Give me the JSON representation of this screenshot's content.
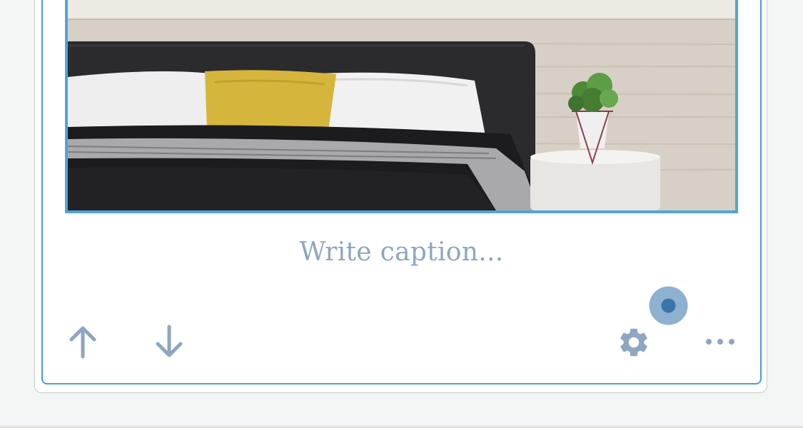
{
  "caption": {
    "placeholder": "Write caption..."
  },
  "image": {
    "alt": "Bedroom with dark upholstered bed, yellow pillow and potted plant on nightstand"
  },
  "toolbar": {
    "move_up": "arrow-up-icon",
    "move_down": "arrow-down-icon",
    "settings": "gear-icon",
    "more": "more-options-icon",
    "notification": "notification-dot-icon"
  },
  "colors": {
    "accent": "#4ea6d6",
    "icon": "#8ea6bf",
    "dot": "#3a74a8",
    "dot_halo": "#8eb1cf"
  }
}
